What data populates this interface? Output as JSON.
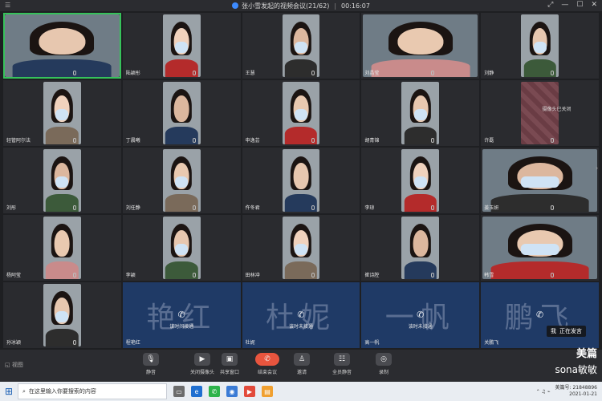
{
  "window": {
    "title": "张小雪发起的视频会议(21/62)",
    "timer": "00:16:07"
  },
  "participants": [
    {
      "name": "",
      "type": "video",
      "full": true,
      "active": true
    },
    {
      "name": "陆颖彤",
      "type": "video"
    },
    {
      "name": "王慧",
      "type": "video"
    },
    {
      "name": "刘晶莹",
      "type": "video",
      "full": true
    },
    {
      "name": "刘静",
      "type": "video"
    },
    {
      "name": "轻管阿尔法",
      "type": "video"
    },
    {
      "name": "丁晨曦",
      "type": "video"
    },
    {
      "name": "申逸芸",
      "type": "video"
    },
    {
      "name": "胡青锦",
      "type": "video"
    },
    {
      "name": "许磊",
      "type": "camoff",
      "status": "摄像头已关闭"
    },
    {
      "name": "刘彤",
      "type": "video"
    },
    {
      "name": "刘任静",
      "type": "video"
    },
    {
      "name": "仵冬君",
      "type": "video"
    },
    {
      "name": "李琼",
      "type": "video"
    },
    {
      "name": "姜玉妍",
      "type": "video",
      "full": true
    },
    {
      "name": "杨阿莹",
      "type": "video"
    },
    {
      "name": "李颖",
      "type": "video"
    },
    {
      "name": "田林冲",
      "type": "video"
    },
    {
      "name": "崔诗腔",
      "type": "video"
    },
    {
      "name": "韩雪",
      "type": "video",
      "full": true
    },
    {
      "name": "孙冰颖",
      "type": "video"
    }
  ],
  "phone_participants": [
    {
      "name": "程艳红",
      "bg": "艳红",
      "status": "该时间接通"
    },
    {
      "name": "杜妮",
      "bg": "杜妮",
      "status": "该时未接通"
    },
    {
      "name": "高一帆",
      "bg": "一帆",
      "status": "该时未接通"
    },
    {
      "name": "关鹏飞",
      "bg": "鹏飞",
      "status": ""
    }
  ],
  "speaking_banner": {
    "who": "我",
    "text": "正在发言"
  },
  "toolbar": {
    "left_text": "◱ 视图",
    "items": [
      "静音",
      "关闭摄像头",
      "共享窗口",
      "结束会议",
      "邀请",
      "全员静音",
      "录制"
    ]
  },
  "watermark": {
    "line1": "美篇",
    "line2": "sona敏敏"
  },
  "taskbar": {
    "search_placeholder": "在这里输入你要搜索的内容",
    "date": "2021-01-21",
    "time": "美篇号: 21848896"
  }
}
